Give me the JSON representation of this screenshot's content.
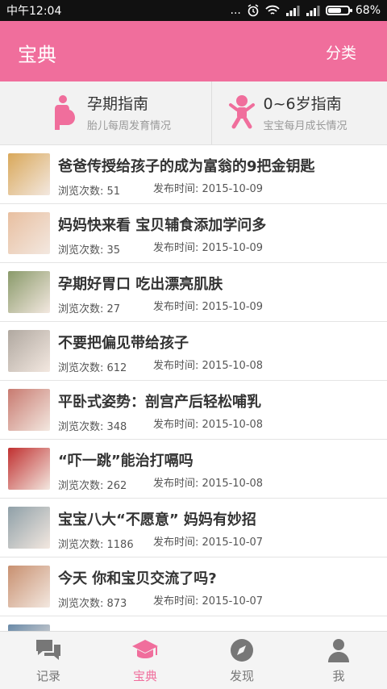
{
  "status_bar": {
    "time": "中午12:04",
    "dots": "...",
    "battery": "68%",
    "battery_level": 0.68
  },
  "header": {
    "title": "宝典",
    "category_label": "分类"
  },
  "guides": [
    {
      "title": "孕期指南",
      "subtitle": "胎儿每周发育情况",
      "icon": "pregnant-icon"
    },
    {
      "title": "0~6岁指南",
      "subtitle": "宝宝每月成长情况",
      "icon": "baby-icon"
    }
  ],
  "articles": [
    {
      "title": "爸爸传授给孩子的成为富翁的9把金钥匙",
      "views": "浏览次数: 51",
      "date": "发布时间: 2015-10-09",
      "thumb_color": "#d9a85a"
    },
    {
      "title": "妈妈快来看 宝贝辅食添加学问多",
      "views": "浏览次数: 35",
      "date": "发布时间: 2015-10-09",
      "thumb_color": "#e8bfa0"
    },
    {
      "title": "孕期好胃口 吃出漂亮肌肤",
      "views": "浏览次数: 27",
      "date": "发布时间: 2015-10-09",
      "thumb_color": "#8a9a6a"
    },
    {
      "title": "不要把偏见带给孩子",
      "views": "浏览次数: 612",
      "date": "发布时间: 2015-10-08",
      "thumb_color": "#b0a8a0"
    },
    {
      "title": "平卧式姿势：剖宫产后轻松哺乳",
      "views": "浏览次数: 348",
      "date": "发布时间: 2015-10-08",
      "thumb_color": "#c87a70"
    },
    {
      "title": "“吓一跳”能治打嗝吗",
      "views": "浏览次数: 262",
      "date": "发布时间: 2015-10-08",
      "thumb_color": "#c03030"
    },
    {
      "title": "宝宝八大“不愿意” 妈妈有妙招",
      "views": "浏览次数: 1186",
      "date": "发布时间: 2015-10-07",
      "thumb_color": "#8fa0a8"
    },
    {
      "title": "今天 你和宝贝交流了吗?",
      "views": "浏览次数: 873",
      "date": "发布时间: 2015-10-07",
      "thumb_color": "#c89070"
    },
    {
      "title": "",
      "views": "",
      "date": "",
      "thumb_color": "#6a8aa8"
    }
  ],
  "tabs": [
    {
      "label": "记录",
      "icon": "chat-icon",
      "active": false
    },
    {
      "label": "宝典",
      "icon": "graduation-cap-icon",
      "active": true
    },
    {
      "label": "发现",
      "icon": "compass-icon",
      "active": false
    },
    {
      "label": "我",
      "icon": "person-icon",
      "active": false
    }
  ],
  "colors": {
    "accent": "#f06e9c",
    "tab_inactive": "#777777"
  }
}
